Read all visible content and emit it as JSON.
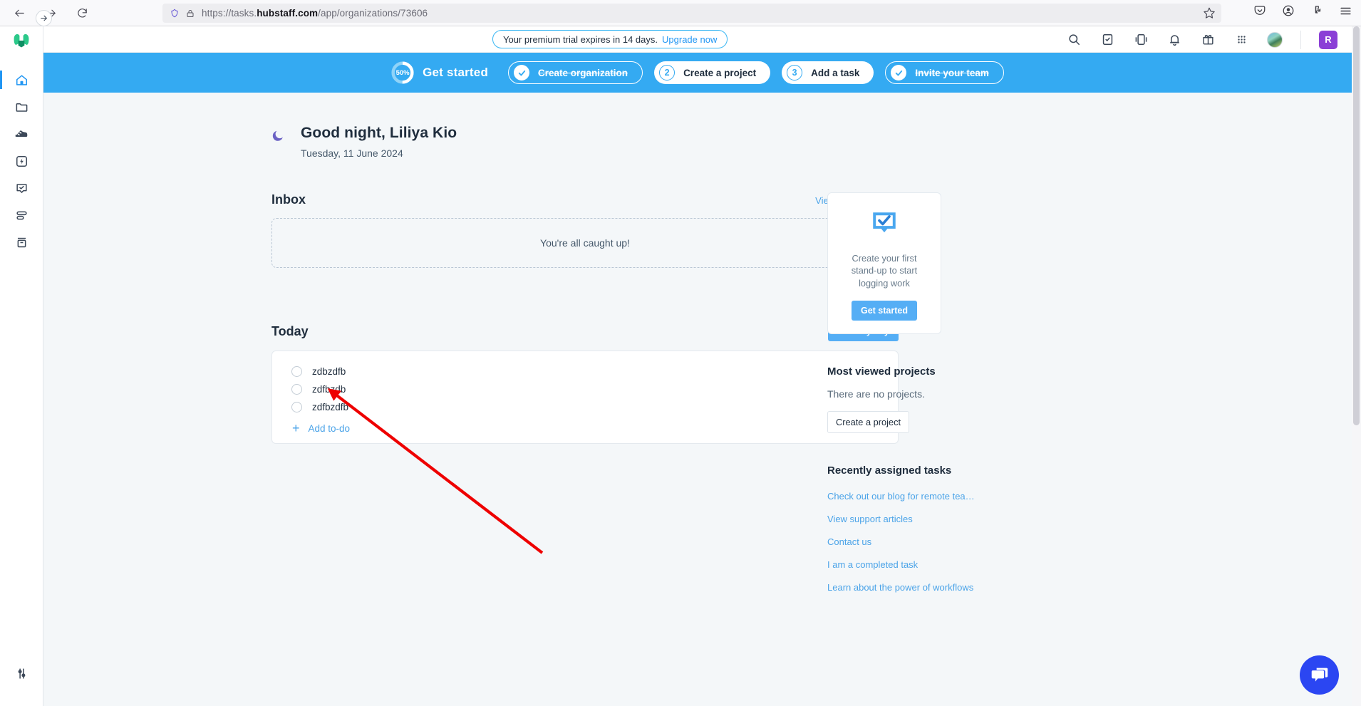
{
  "browser": {
    "back_icon": "back-arrow-icon",
    "forward_icon": "forward-arrow-icon",
    "reload_icon": "reload-icon",
    "shield_icon": "shield-icon",
    "lock_icon": "padlock-icon",
    "url_prefix": "https://tasks.",
    "url_domain": "hubstaff.com",
    "url_suffix": "/app/organizations/73606",
    "url_full": "https://tasks.hubstaff.com/app/organizations/73606",
    "bookmark_icon": "star-icon",
    "toolbar_icons": [
      "pocket-icon",
      "account-icon",
      "extensions-icon",
      "menu-icon"
    ]
  },
  "rail": {
    "logo": "hubstaff-logo-icon",
    "collapse_icon": "expand-arrow-icon",
    "items": [
      {
        "name": "home",
        "icon": "home-icon",
        "active": true
      },
      {
        "name": "projects",
        "icon": "folder-icon",
        "active": false
      },
      {
        "name": "activity",
        "icon": "shoe-icon",
        "active": false
      },
      {
        "name": "insights",
        "icon": "bolt-box-icon",
        "active": false
      },
      {
        "name": "standups",
        "icon": "checkbox-chat-icon",
        "active": false
      },
      {
        "name": "timesheets",
        "icon": "rows-icon",
        "active": false
      },
      {
        "name": "reports",
        "icon": "archive-icon",
        "active": false
      }
    ],
    "bottom_item": {
      "name": "settings",
      "icon": "sliders-icon"
    }
  },
  "header": {
    "trial_text": "Your premium trial expires in 14 days.",
    "trial_cta": "Upgrade now",
    "icons": [
      {
        "name": "search",
        "icon": "search-icon"
      },
      {
        "name": "tasks",
        "icon": "clipboard-check-icon"
      },
      {
        "name": "sidebar",
        "icon": "panel-icon"
      },
      {
        "name": "notifications",
        "icon": "bell-icon"
      },
      {
        "name": "rewards",
        "icon": "gift-icon"
      },
      {
        "name": "apps",
        "icon": "grid-apps-icon"
      }
    ],
    "avatar": "user-avatar",
    "user_initial": "R"
  },
  "onboarding": {
    "percent": "50%",
    "title": "Get started",
    "steps": [
      {
        "label": "Create organization",
        "state": "done",
        "marker": "check-icon"
      },
      {
        "label": "Create a project",
        "state": "todo",
        "marker": "2"
      },
      {
        "label": "Add a task",
        "state": "todo",
        "marker": "3"
      },
      {
        "label": "Invite your team",
        "state": "done",
        "marker": "check-icon"
      }
    ]
  },
  "greeting": {
    "icon": "moon-icon",
    "title": "Good night, Liliya Kio",
    "date": "Tuesday, 11 June 2024"
  },
  "inbox": {
    "title": "Inbox",
    "view_all": "View all notifications",
    "empty_text": "You're all caught up!"
  },
  "today": {
    "title": "Today",
    "plan_button": "Plan my day",
    "todos": [
      {
        "label": "zdbzdfb",
        "done": false
      },
      {
        "label": "zdfbzdb",
        "done": false
      },
      {
        "label": "zdfbzdfb",
        "done": false
      }
    ],
    "add_label": "Add to-do",
    "add_icon": "plus-icon"
  },
  "standup": {
    "icon": "standup-chat-check-icon",
    "text": "Create your first stand-up to start logging work",
    "button": "Get started"
  },
  "projects": {
    "title": "Most viewed projects",
    "empty": "There are no projects.",
    "button": "Create a project"
  },
  "recent_tasks": {
    "title": "Recently assigned tasks",
    "items": [
      "Check out our blog for remote tea…",
      "View support articles",
      "Contact us",
      "I am a completed task",
      "Learn about the power of workflows"
    ]
  },
  "chat": {
    "icon": "chat-bubbles-icon"
  },
  "annotation": {
    "color": "#ee0000",
    "shape": "arrow-pointer"
  },
  "colors": {
    "accent_blue": "#34aaf2",
    "button_blue": "#55aef5",
    "link_blue": "#4aa3e8",
    "badge_purple": "#8b3fd6",
    "chat_blue": "#2b46f2",
    "page_bg": "#f4f7f9",
    "text_dark": "#1f2d3d"
  }
}
